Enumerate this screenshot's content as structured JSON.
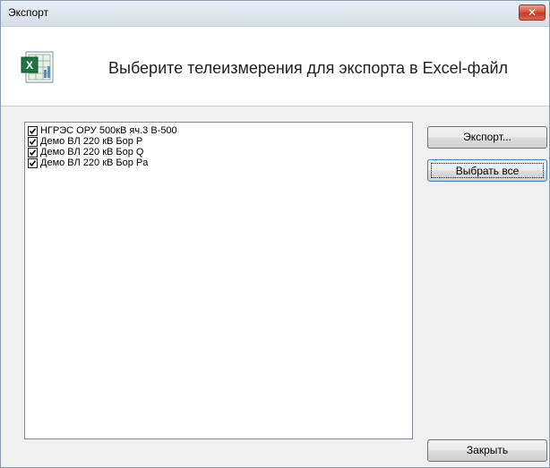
{
  "window": {
    "title": "Экспорт",
    "close_glyph": "✕"
  },
  "header": {
    "icon": "excel-icon",
    "text": "Выберите телеизмерения для экспорта в Excel-файл"
  },
  "measurements": [
    {
      "label": "НГРЭС ОРУ 500кВ яч.3 В-500",
      "checked": true
    },
    {
      "label": "Демо ВЛ 220 кВ Бор P",
      "checked": true
    },
    {
      "label": "Демо ВЛ 220 кВ Бор Q",
      "checked": true
    },
    {
      "label": "Демо ВЛ 220 кВ Бор Pa",
      "checked": true
    }
  ],
  "buttons": {
    "export": "Экспорт...",
    "select_all": "Выбрать все",
    "close": "Закрыть"
  },
  "colors": {
    "accent": "#217346",
    "close_button": "#c43a25"
  }
}
